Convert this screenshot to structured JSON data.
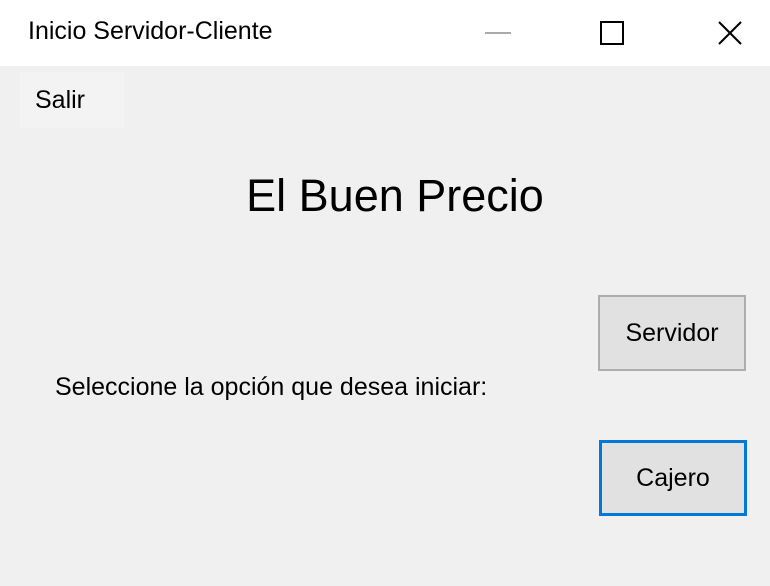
{
  "window": {
    "title": "Inicio Servidor-Cliente",
    "controls": {
      "minimize_icon": "minimize-icon",
      "maximize_icon": "maximize-icon",
      "close_icon": "close-icon"
    }
  },
  "menu": {
    "items": [
      {
        "label": "Salir"
      }
    ]
  },
  "main": {
    "heading": "El Buen Precio",
    "prompt": "Seleccione la opción que desea iniciar:",
    "buttons": {
      "servidor": "Servidor",
      "cajero": "Cajero"
    }
  },
  "colors": {
    "window_background": "#f0f0f0",
    "titlebar_background": "#ffffff",
    "button_background": "#e1e1e1",
    "button_border": "#adadad",
    "focus_border": "#0078d7"
  }
}
